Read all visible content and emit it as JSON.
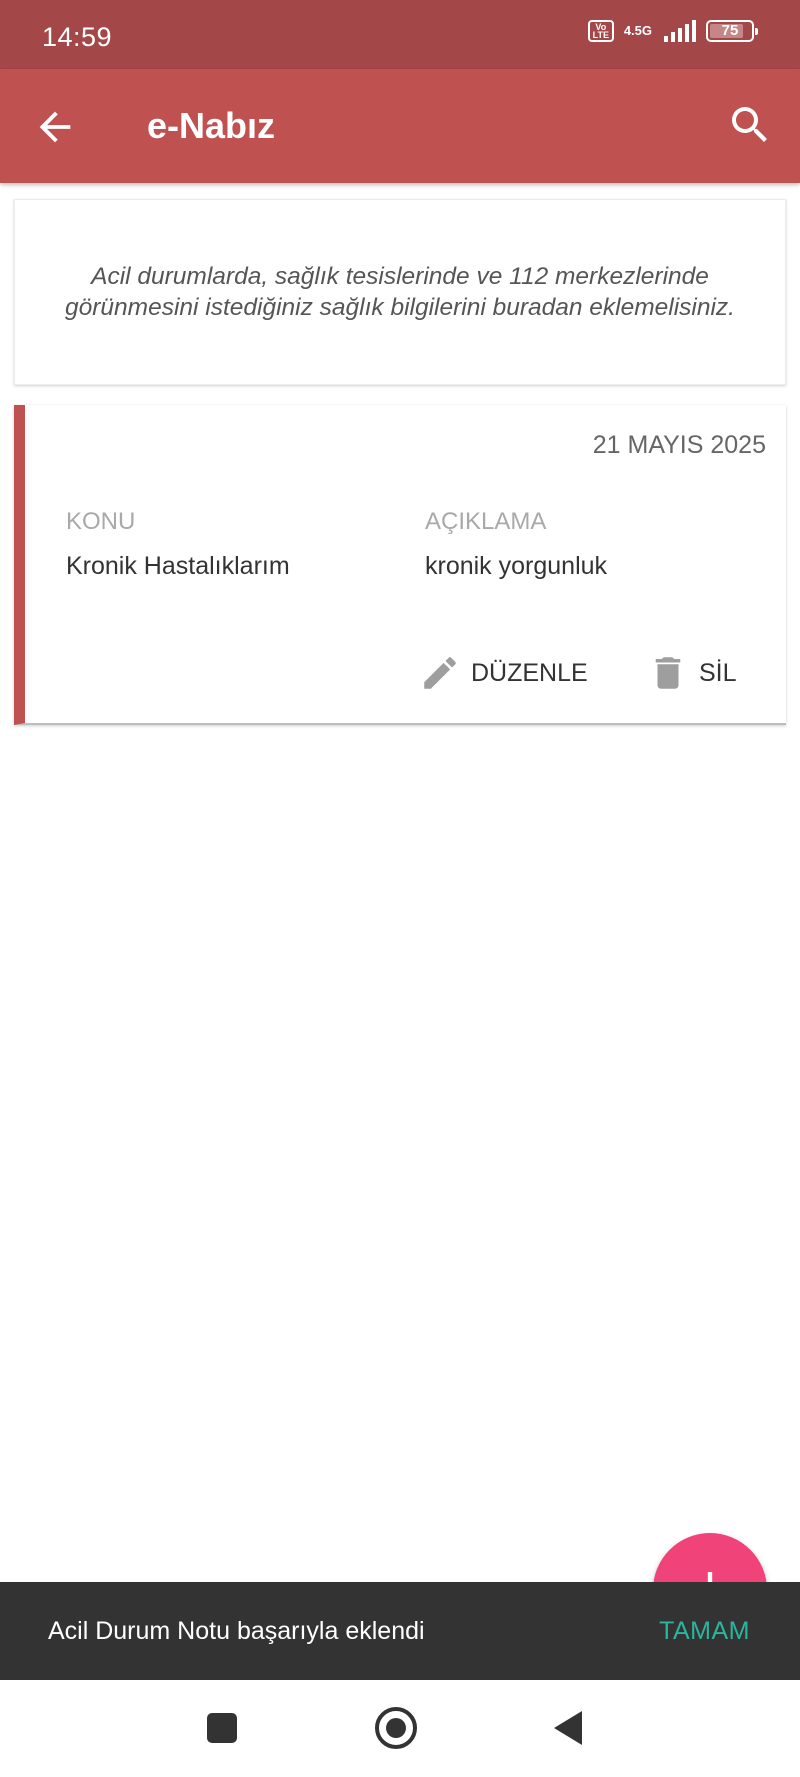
{
  "status_bar": {
    "time": "14:59",
    "volte_label": "Vo LTE",
    "network_label": "4.5G",
    "battery_level": "75",
    "battery_fraction": 0.75
  },
  "app_bar": {
    "title": "e-Nabız",
    "back_icon": "arrow-left-icon",
    "search_icon": "search-icon"
  },
  "info_card": {
    "text": "Acil durumlarda, sağlık tesislerinde ve 112 merkezlerinde görünmesini istediğiniz sağlık bilgilerini buradan eklemelisiniz."
  },
  "note_card": {
    "date": "21 MAYIS 2025",
    "subject_label": "KONU",
    "subject_value": "Kronik Hastalıklarım",
    "description_label": "AÇIKLAMA",
    "description_value": "kronik yorgunluk",
    "edit_label": "DÜZENLE",
    "delete_label": "SİL",
    "accent_color": "#c05151"
  },
  "fab": {
    "label": "+",
    "color": "#f0437a"
  },
  "snackbar": {
    "message": "Acil Durum Notu başarıyla eklendi",
    "action_label": "TAMAM",
    "action_color": "#2bb5a0"
  },
  "colors": {
    "status_bar": "#a34748",
    "app_bar": "#c05151"
  }
}
